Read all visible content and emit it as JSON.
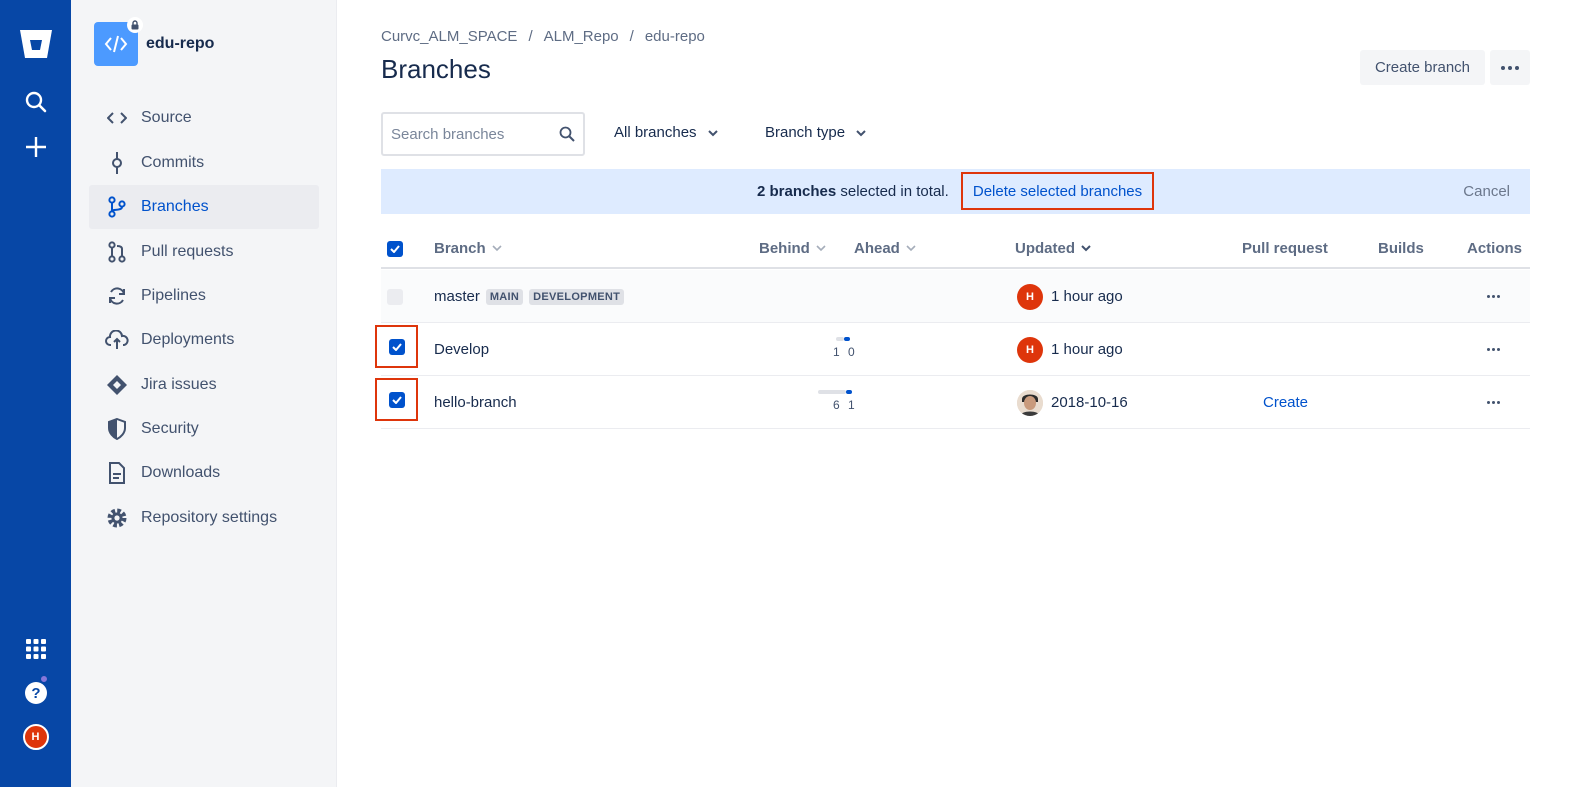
{
  "global_nav": {
    "avatar_initial": "H",
    "icons": [
      "bitbucket-logo-icon",
      "search-icon",
      "plus-icon",
      "app-switcher-icon",
      "help-icon"
    ]
  },
  "sidebar": {
    "repo_name": "edu-repo",
    "items": [
      {
        "label": "Source",
        "icon": "source-icon"
      },
      {
        "label": "Commits",
        "icon": "commit-icon"
      },
      {
        "label": "Branches",
        "icon": "branch-icon",
        "active": true
      },
      {
        "label": "Pull requests",
        "icon": "pull-request-icon"
      },
      {
        "label": "Pipelines",
        "icon": "pipelines-icon"
      },
      {
        "label": "Deployments",
        "icon": "deployments-icon"
      },
      {
        "label": "Jira issues",
        "icon": "jira-icon"
      },
      {
        "label": "Security",
        "icon": "shield-icon"
      },
      {
        "label": "Downloads",
        "icon": "download-icon"
      },
      {
        "label": "Repository settings",
        "icon": "gear-icon"
      }
    ]
  },
  "header": {
    "breadcrumb": [
      "Curvc_ALM_SPACE",
      "ALM_Repo",
      "edu-repo"
    ],
    "separator": "/",
    "title": "Branches",
    "create_branch_label": "Create branch"
  },
  "filters": {
    "search_placeholder": "Search branches",
    "all_branches": "All branches",
    "branch_type": "Branch type"
  },
  "selection_bar": {
    "count": "2 branches",
    "suffix": " selected in total.",
    "delete_label": "Delete selected branches",
    "cancel_label": "Cancel"
  },
  "table": {
    "columns": {
      "branch": "Branch",
      "behind": "Behind",
      "ahead": "Ahead",
      "updated": "Updated",
      "pull_request": "Pull request",
      "builds": "Builds",
      "actions": "Actions"
    },
    "rows": [
      {
        "name": "master",
        "tags": [
          "MAIN",
          "DEVELOPMENT"
        ],
        "checked": false,
        "behind": "",
        "ahead": "",
        "updated_by": "H",
        "updated": "1 hour ago",
        "pull_request": ""
      },
      {
        "name": "Develop",
        "tags": [],
        "checked": true,
        "behind": "1",
        "ahead": "0",
        "updated_by": "H",
        "updated": "1 hour ago",
        "pull_request": ""
      },
      {
        "name": "hello-branch",
        "tags": [],
        "checked": true,
        "behind": "6",
        "ahead": "1",
        "updated_by": "photo",
        "updated": "2018-10-16",
        "pull_request": "Create"
      }
    ]
  },
  "colors": {
    "nav": "#0747a6",
    "accent": "#0052cc",
    "highlight": "#de350b",
    "selection_bg": "#deebff"
  }
}
